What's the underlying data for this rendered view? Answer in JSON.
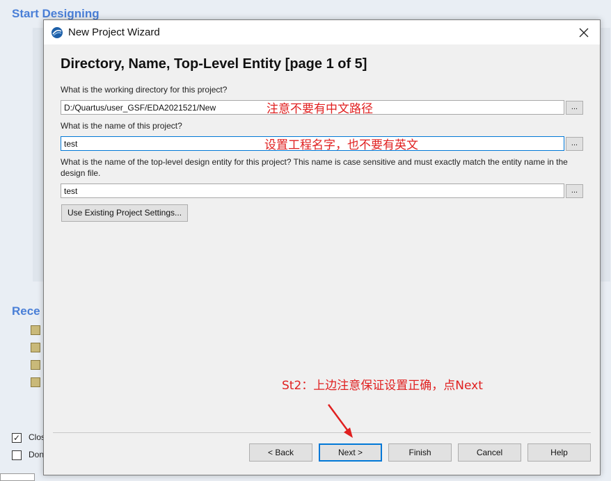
{
  "background": {
    "start_title": "Start Designing",
    "recent_title": "Rece",
    "checkbox1_label": "Clos",
    "checkbox2_label": "Don"
  },
  "dialog": {
    "title": "New Project Wizard",
    "heading": "Directory, Name, Top-Level Entity [page 1 of 5]",
    "dir_label": "What is the working directory for this project?",
    "dir_value": "D:/Quartus/user_GSF/EDA2021521/New",
    "name_label": "What is the name of this project?",
    "name_value": "test",
    "entity_label": "What is the name of the top-level design entity for this project? This name is case sensitive and must exactly match the entity name in the design file.",
    "entity_value": "test",
    "browse_label": "...",
    "existing_button": "Use Existing Project Settings...",
    "buttons": {
      "back": "< Back",
      "next": "Next >",
      "finish": "Finish",
      "cancel": "Cancel",
      "help": "Help"
    }
  },
  "annotations": {
    "dir_note": "注意不要有中文路径",
    "name_note": "设置工程名字，也不要有英文",
    "step_note": "St2：上边注意保证设置正确，点Next"
  },
  "colors": {
    "annotation": "#e02020",
    "accent": "#0078d7",
    "bg_title": "#4a7fd7"
  }
}
